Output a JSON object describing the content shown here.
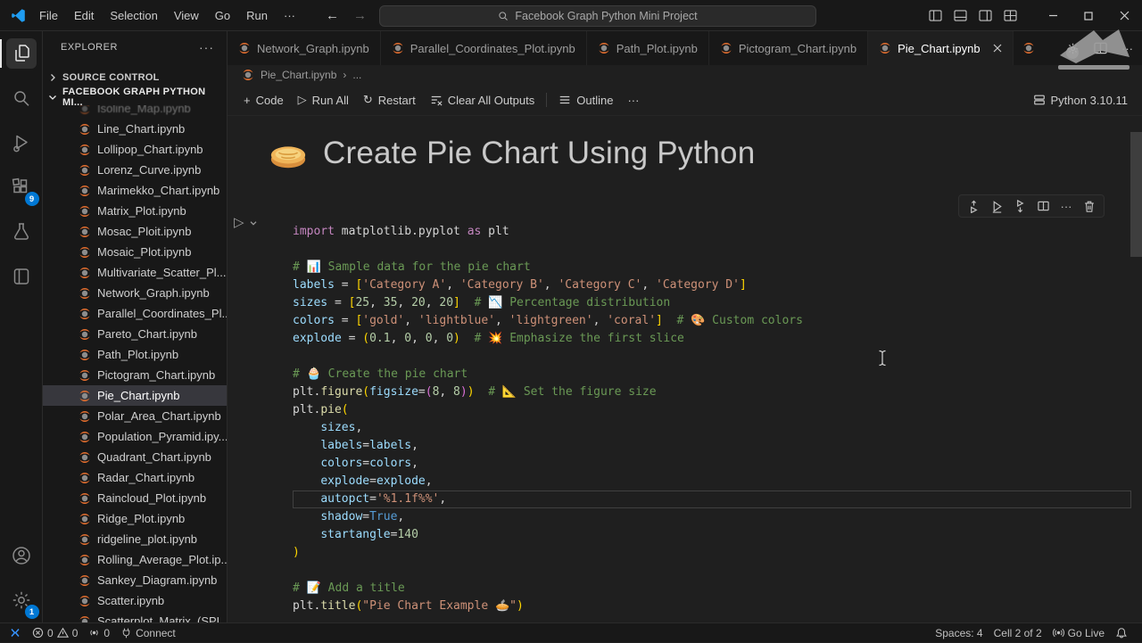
{
  "window": {
    "menus": [
      "File",
      "Edit",
      "Selection",
      "View",
      "Go",
      "Run",
      "···"
    ],
    "search_text": "Facebook Graph Python Mini Project"
  },
  "activity_bar": {
    "extensions_badge": "9",
    "settings_badge": "1"
  },
  "sidebar": {
    "header": "EXPLORER",
    "source_control": "SOURCE CONTROL",
    "project": "FACEBOOK GRAPH PYTHON MI...",
    "files": [
      {
        "name": "Isoline_Map.ipynb",
        "partial": true
      },
      {
        "name": "Line_Chart.ipynb"
      },
      {
        "name": "Lollipop_Chart.ipynb"
      },
      {
        "name": "Lorenz_Curve.ipynb"
      },
      {
        "name": "Marimekko_Chart.ipynb"
      },
      {
        "name": "Matrix_Plot.ipynb"
      },
      {
        "name": "Mosac_Ploit.ipynb"
      },
      {
        "name": "Mosaic_Plot.ipynb"
      },
      {
        "name": "Multivariate_Scatter_Pl..."
      },
      {
        "name": "Network_Graph.ipynb"
      },
      {
        "name": "Parallel_Coordinates_Pl..."
      },
      {
        "name": "Pareto_Chart.ipynb"
      },
      {
        "name": "Path_Plot.ipynb"
      },
      {
        "name": "Pictogram_Chart.ipynb"
      },
      {
        "name": "Pie_Chart.ipynb",
        "selected": true
      },
      {
        "name": "Polar_Area_Chart.ipynb"
      },
      {
        "name": "Population_Pyramid.ipy..."
      },
      {
        "name": "Quadrant_Chart.ipynb"
      },
      {
        "name": "Radar_Chart.ipynb"
      },
      {
        "name": "Raincloud_Plot.ipynb"
      },
      {
        "name": "Ridge_Plot.ipynb"
      },
      {
        "name": "ridgeline_plot.ipynb"
      },
      {
        "name": "Rolling_Average_Plot.ip..."
      },
      {
        "name": "Sankey_Diagram.ipynb"
      },
      {
        "name": "Scatter.ipynb"
      },
      {
        "name": "Scatterplot_Matrix_(SPL..."
      }
    ]
  },
  "tabs": [
    {
      "label": "Network_Graph.ipynb"
    },
    {
      "label": "Parallel_Coordinates_Plot.ipynb"
    },
    {
      "label": "Path_Plot.ipynb"
    },
    {
      "label": "Pictogram_Chart.ipynb"
    },
    {
      "label": "Pie_Chart.ipynb",
      "active": true
    },
    {
      "label": "",
      "partial": true
    }
  ],
  "breadcrumb": {
    "file": "Pie_Chart.ipynb",
    "more": "..."
  },
  "toolbar": {
    "code": "Code",
    "run_all": "Run All",
    "restart": "Restart",
    "clear": "Clear All Outputs",
    "outline": "Outline",
    "more": "···",
    "kernel": "Python 3.10.11"
  },
  "heading": {
    "title": "Create Pie Chart Using Python"
  },
  "code": {
    "current_line": 16,
    "lines": [
      [
        [
          "k",
          "import"
        ],
        [
          "p",
          " matplotlib.pyplot "
        ],
        [
          "k",
          "as"
        ],
        [
          "p",
          " plt"
        ]
      ],
      [],
      [
        [
          "c",
          "# 📊 Sample data for the pie chart"
        ]
      ],
      [
        [
          "v",
          "labels"
        ],
        [
          "p",
          " = "
        ],
        [
          "g",
          "["
        ],
        [
          "s",
          "'Category A'"
        ],
        [
          "p",
          ", "
        ],
        [
          "s",
          "'Category B'"
        ],
        [
          "p",
          ", "
        ],
        [
          "s",
          "'Category C'"
        ],
        [
          "p",
          ", "
        ],
        [
          "s",
          "'Category D'"
        ],
        [
          "g",
          "]"
        ]
      ],
      [
        [
          "v",
          "sizes"
        ],
        [
          "p",
          " = "
        ],
        [
          "g",
          "["
        ],
        [
          "n",
          "25"
        ],
        [
          "p",
          ", "
        ],
        [
          "n",
          "35"
        ],
        [
          "p",
          ", "
        ],
        [
          "n",
          "20"
        ],
        [
          "p",
          ", "
        ],
        [
          "n",
          "20"
        ],
        [
          "g",
          "]"
        ],
        [
          "p",
          "  "
        ],
        [
          "c",
          "# 📉 Percentage distribution"
        ]
      ],
      [
        [
          "v",
          "colors"
        ],
        [
          "p",
          " = "
        ],
        [
          "g",
          "["
        ],
        [
          "s",
          "'gold'"
        ],
        [
          "p",
          ", "
        ],
        [
          "s",
          "'lightblue'"
        ],
        [
          "p",
          ", "
        ],
        [
          "s",
          "'lightgreen'"
        ],
        [
          "p",
          ", "
        ],
        [
          "s",
          "'coral'"
        ],
        [
          "g",
          "]"
        ],
        [
          "p",
          "  "
        ],
        [
          "c",
          "# 🎨 Custom colors"
        ]
      ],
      [
        [
          "v",
          "explode"
        ],
        [
          "p",
          " = "
        ],
        [
          "g",
          "("
        ],
        [
          "n",
          "0.1"
        ],
        [
          "p",
          ", "
        ],
        [
          "n",
          "0"
        ],
        [
          "p",
          ", "
        ],
        [
          "n",
          "0"
        ],
        [
          "p",
          ", "
        ],
        [
          "n",
          "0"
        ],
        [
          "g",
          ")"
        ],
        [
          "p",
          "  "
        ],
        [
          "c",
          "# 💥 Emphasize the first slice"
        ]
      ],
      [],
      [
        [
          "c",
          "# 🧁 Create the pie chart"
        ]
      ],
      [
        [
          "p",
          "plt."
        ],
        [
          "f",
          "figure"
        ],
        [
          "g",
          "("
        ],
        [
          "v",
          "figsize"
        ],
        [
          "p",
          "="
        ],
        [
          "m",
          "("
        ],
        [
          "n",
          "8"
        ],
        [
          "p",
          ", "
        ],
        [
          "n",
          "8"
        ],
        [
          "m",
          ")"
        ],
        [
          "g",
          ")"
        ],
        [
          "p",
          "  "
        ],
        [
          "c",
          "# 📐 Set the figure size"
        ]
      ],
      [
        [
          "p",
          "plt."
        ],
        [
          "f",
          "pie"
        ],
        [
          "g",
          "("
        ]
      ],
      [
        [
          "p",
          "    "
        ],
        [
          "v",
          "sizes"
        ],
        [
          "p",
          ","
        ]
      ],
      [
        [
          "p",
          "    "
        ],
        [
          "v",
          "labels"
        ],
        [
          "p",
          "="
        ],
        [
          "v",
          "labels"
        ],
        [
          "p",
          ","
        ]
      ],
      [
        [
          "p",
          "    "
        ],
        [
          "v",
          "colors"
        ],
        [
          "p",
          "="
        ],
        [
          "v",
          "colors"
        ],
        [
          "p",
          ","
        ]
      ],
      [
        [
          "p",
          "    "
        ],
        [
          "v",
          "explode"
        ],
        [
          "p",
          "="
        ],
        [
          "v",
          "explode"
        ],
        [
          "p",
          ","
        ]
      ],
      [
        [
          "p",
          "    "
        ],
        [
          "v",
          "autopct"
        ],
        [
          "p",
          "="
        ],
        [
          "s",
          "'%1.1f%%'"
        ],
        [
          "p",
          ","
        ]
      ],
      [
        [
          "p",
          "    "
        ],
        [
          "v",
          "shadow"
        ],
        [
          "p",
          "="
        ],
        [
          "t",
          "True"
        ],
        [
          "p",
          ","
        ]
      ],
      [
        [
          "p",
          "    "
        ],
        [
          "v",
          "startangle"
        ],
        [
          "p",
          "="
        ],
        [
          "n",
          "140"
        ]
      ],
      [
        [
          "g",
          ")"
        ]
      ],
      [],
      [
        [
          "c",
          "# 📝 Add a title"
        ]
      ],
      [
        [
          "p",
          "plt."
        ],
        [
          "f",
          "title"
        ],
        [
          "g",
          "("
        ],
        [
          "s",
          "\"Pie Chart Example 🥧\""
        ],
        [
          "g",
          ")"
        ]
      ]
    ]
  },
  "status": {
    "errors": "0",
    "warnings": "0",
    "ports": "0",
    "connect": "Connect",
    "spaces": "Spaces: 4",
    "cell": "Cell 2 of 2",
    "golive": "Go Live"
  },
  "colors": {
    "accent": "#0078d4",
    "jupyter_orange": "#e46e2e",
    "remote_blue": "#3794ff"
  }
}
